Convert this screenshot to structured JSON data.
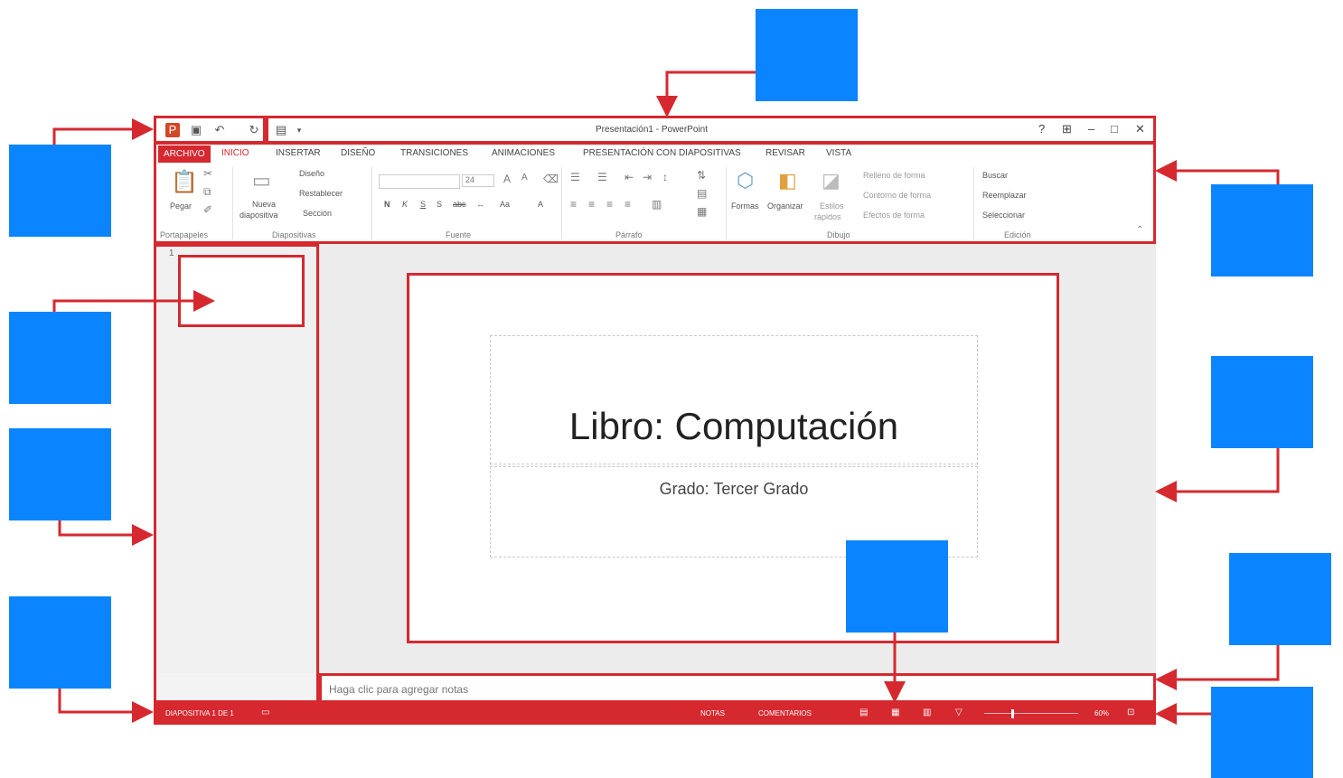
{
  "window": {
    "title": "Presentación1 - PowerPoint",
    "help": "?",
    "restore_ribbon": "⊞",
    "minimize": "–",
    "maximize": "□",
    "close": "✕"
  },
  "quick_access": [
    "powerpoint-icon",
    "save-icon",
    "undo-icon",
    "redo-icon",
    "customize-icon"
  ],
  "tabs": {
    "file": "ARCHIVO",
    "items": [
      "INICIO",
      "INSERTAR",
      "DISEÑO",
      "TRANSICIONES",
      "ANIMACIONES",
      "PRESENTACIÓN CON DIAPOSITIVAS",
      "REVISAR",
      "VISTA"
    ]
  },
  "ribbon": {
    "clipboard": {
      "paste": "Pegar",
      "group": "Portapapeles"
    },
    "slides": {
      "new_slide_1": "Nueva",
      "new_slide_2": "diapositiva",
      "layout": "Diseño",
      "reset": "Restablecer",
      "section": "Sección",
      "group": "Diapositivas"
    },
    "font": {
      "size": "24",
      "bold": "N",
      "italic": "K",
      "underline": "S",
      "shadow": "S",
      "strike": "abc",
      "case": "Aa",
      "color": "A",
      "group": "Fuente"
    },
    "paragraph": {
      "group": "Párrafo"
    },
    "drawing": {
      "shapes": "Formas",
      "arrange": "Organizar",
      "quick_styles_1": "Estilos",
      "quick_styles_2": "rápidos",
      "fill": "Relleno de forma",
      "outline": "Contorno de forma",
      "effects": "Efectos de forma",
      "group": "Dibujo"
    },
    "editing": {
      "find": "Buscar",
      "replace": "Reemplazar",
      "select": "Seleccionar",
      "group": "Edición"
    }
  },
  "thumbnails": {
    "slide_number": "1"
  },
  "slide": {
    "title": "Libro: Computación",
    "subtitle": "Grado: Tercer Grado"
  },
  "notes": {
    "placeholder": "Haga clic para agregar notas"
  },
  "status": {
    "slide_info": "DIAPOSITIVA 1 DE 1",
    "notes": "NOTAS",
    "comments": "COMENTARIOS",
    "zoom": "60%"
  },
  "colors": {
    "accent": "#d6282f",
    "callout": "#0a84ff"
  }
}
